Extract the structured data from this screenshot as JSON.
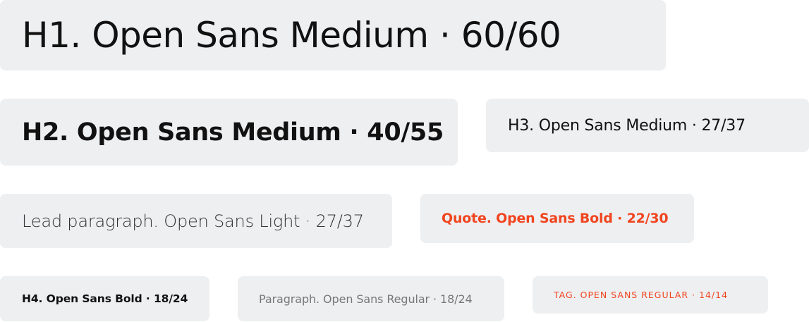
{
  "type_specimens": {
    "h1": "H1. Open Sans Medium · 60/60",
    "h2": "H2. Open Sans Medium · 40/55",
    "h3": "H3. Open Sans Medium · 27/37",
    "lead": "Lead paragraph. Open Sans Light · 27/37",
    "quote": "Quote. Open Sans Bold · 22/30",
    "h4": "H4. Open Sans Bold · 18/24",
    "paragraph": "Paragraph. Open Sans Regular · 18/24",
    "tag": "TAG. OPEN SANS REGULAR · 14/14"
  },
  "colors": {
    "chip_background": "#eeeff1",
    "text_primary": "#111111",
    "accent": "#f0451f",
    "muted": "#777777"
  }
}
